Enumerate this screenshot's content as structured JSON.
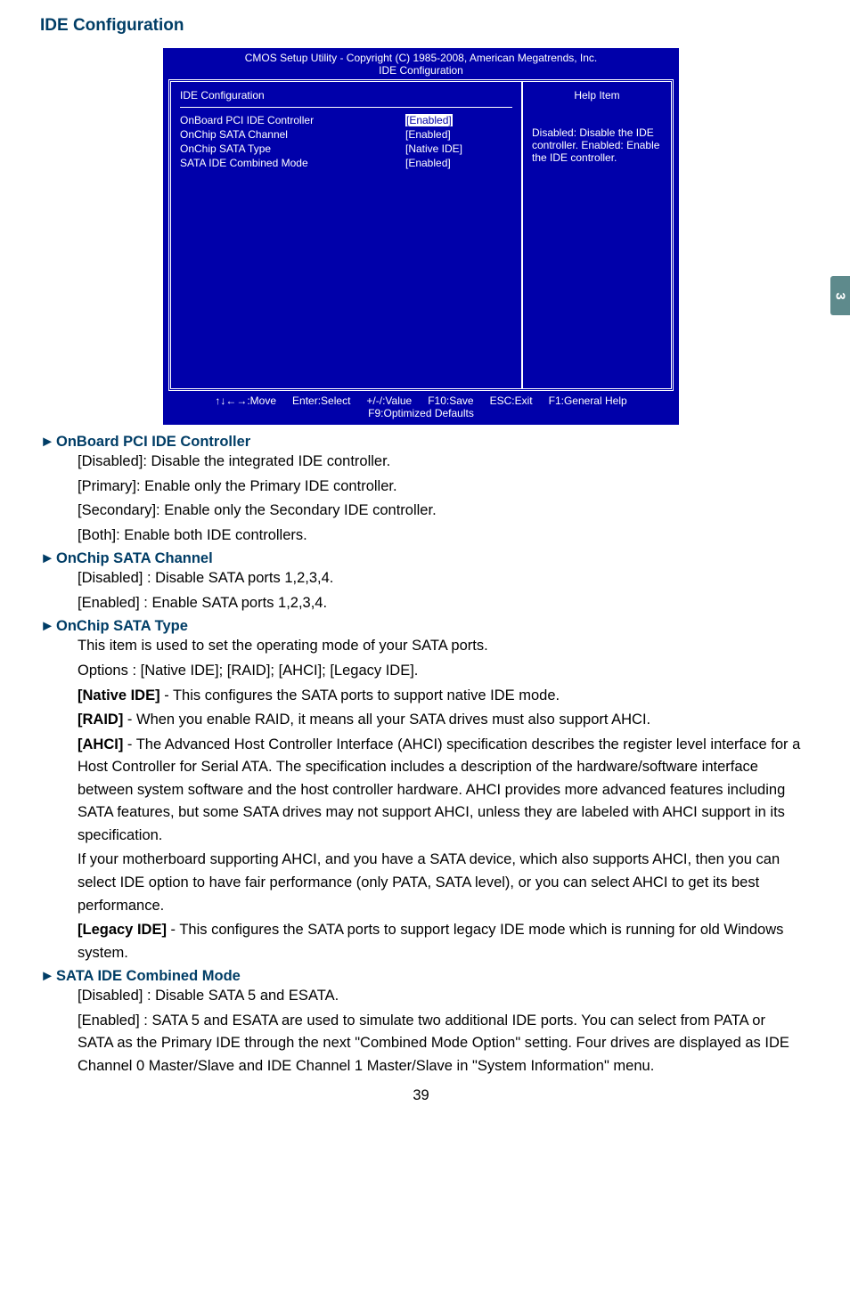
{
  "page": {
    "tab_number": "3",
    "page_number": "39",
    "section_title": "IDE Configuration"
  },
  "bios": {
    "header": "CMOS Setup Utility - Copyright (C) 1985-2008, American Megatrends, Inc.",
    "subheader": "IDE Configuration",
    "category_left": "IDE Configuration",
    "category_right": "Help Item",
    "settings": [
      {
        "label": "OnBoard PCI IDE Controller",
        "value": "[Enabled]"
      },
      {
        "label": "OnChip SATA Channel",
        "value": "[Enabled]"
      },
      {
        "label": "OnChip SATA Type",
        "value": "[Native IDE]"
      },
      {
        "label": "SATA IDE Combined Mode",
        "value": "[Enabled]"
      }
    ],
    "help_text": "Disabled: Disable the IDE controller. Enabled: Enable the IDE controller.",
    "footer": {
      "move": "↑↓←→:Move",
      "select": "Enter:Select",
      "value": "+/-/:Value",
      "save": "F10:Save",
      "exit": "ESC:Exit",
      "help": "F1:General Help",
      "defaults": "F9:Optimized Defaults"
    }
  },
  "items": {
    "onboard_pci": {
      "title": "OnBoard PCI IDE Controller",
      "line1": "[Disabled]: Disable the integrated IDE controller.",
      "line2": "[Primary]: Enable only the Primary IDE controller.",
      "line3": "[Secondary]: Enable only the Secondary IDE controller.",
      "line4": "[Both]: Enable both IDE controllers."
    },
    "onchip_channel": {
      "title": "OnChip SATA Channel",
      "line1": "[Disabled] : Disable SATA ports 1,2,3,4.",
      "line2": "[Enabled] : Enable SATA ports 1,2,3,4."
    },
    "onchip_type": {
      "title": "OnChip SATA Type",
      "line1": "This item is used to set the operating mode of your SATA ports.",
      "line2": "Options : [Native IDE]; [RAID]; [AHCI]; [Legacy IDE].",
      "native_bold": "[Native IDE]",
      "native_rest": " - This configures the SATA ports to support native IDE mode.",
      "raid_bold": "[RAID]",
      "raid_rest": " - When you enable RAID, it means all your SATA drives must also support AHCI.",
      "ahci_bold": "[AHCI]",
      "ahci_rest": " - The Advanced Host Controller Interface (AHCI) specification describes the register level interface for a Host Controller for Serial ATA. The specification includes a description of the hardware/software interface between system software and the host controller hardware. AHCI provides more advanced features including SATA features, but some SATA drives may not support AHCI, unless they are labeled with AHCI support in its specification.",
      "ahci_para2": "If your motherboard supporting AHCI, and you have a SATA device, which also supports AHCI, then you can select IDE option to have fair performance (only PATA, SATA level), or you can select AHCI to get its best performance.",
      "legacy_bold": "[Legacy IDE]",
      "legacy_rest": " - This configures the SATA ports to support legacy IDE mode which is running for old Windows system."
    },
    "combined": {
      "title": "SATA IDE Combined Mode",
      "line1": "[Disabled] : Disable SATA 5 and ESATA.",
      "line2": "[Enabled] : SATA 5 and ESATA are used to simulate two additional IDE ports. You can select from PATA or SATA as the Primary IDE through the next \"Combined Mode Option\" setting. Four drives are displayed as IDE Channel 0 Master/Slave and IDE Channel 1 Master/Slave in \"System Information\" menu."
    }
  }
}
